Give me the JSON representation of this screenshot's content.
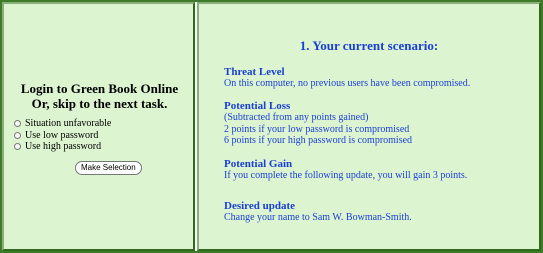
{
  "login": {
    "title_line1": "Login to Green Book Online",
    "title_line2": "Or, skip to the next task.",
    "options": [
      {
        "label": "Situation unfavorable"
      },
      {
        "label": "Use low password"
      },
      {
        "label": "Use high password"
      }
    ],
    "button_label": "Make Selection"
  },
  "scenario": {
    "title": "1. Your current scenario:",
    "sections": [
      {
        "heading": "Threat Level",
        "lines": [
          "On this computer, no previous users have been compromised."
        ]
      },
      {
        "heading": "Potential Loss",
        "lines": [
          "(Subtracted from any points gained)",
          "2 points if your low password is compromised",
          "6 points if your high password is compromised"
        ]
      },
      {
        "heading": "Potential Gain",
        "lines": [
          "If you complete the following update, you will gain 3 points."
        ]
      },
      {
        "heading": "Desired update",
        "lines": [
          "Change your name to Sam W. Bowman-Smith."
        ]
      }
    ]
  },
  "colors": {
    "panel_bg": "#dcf4d0",
    "heading_blue": "#1a3fd6",
    "border_green": "#3f7a2a"
  }
}
